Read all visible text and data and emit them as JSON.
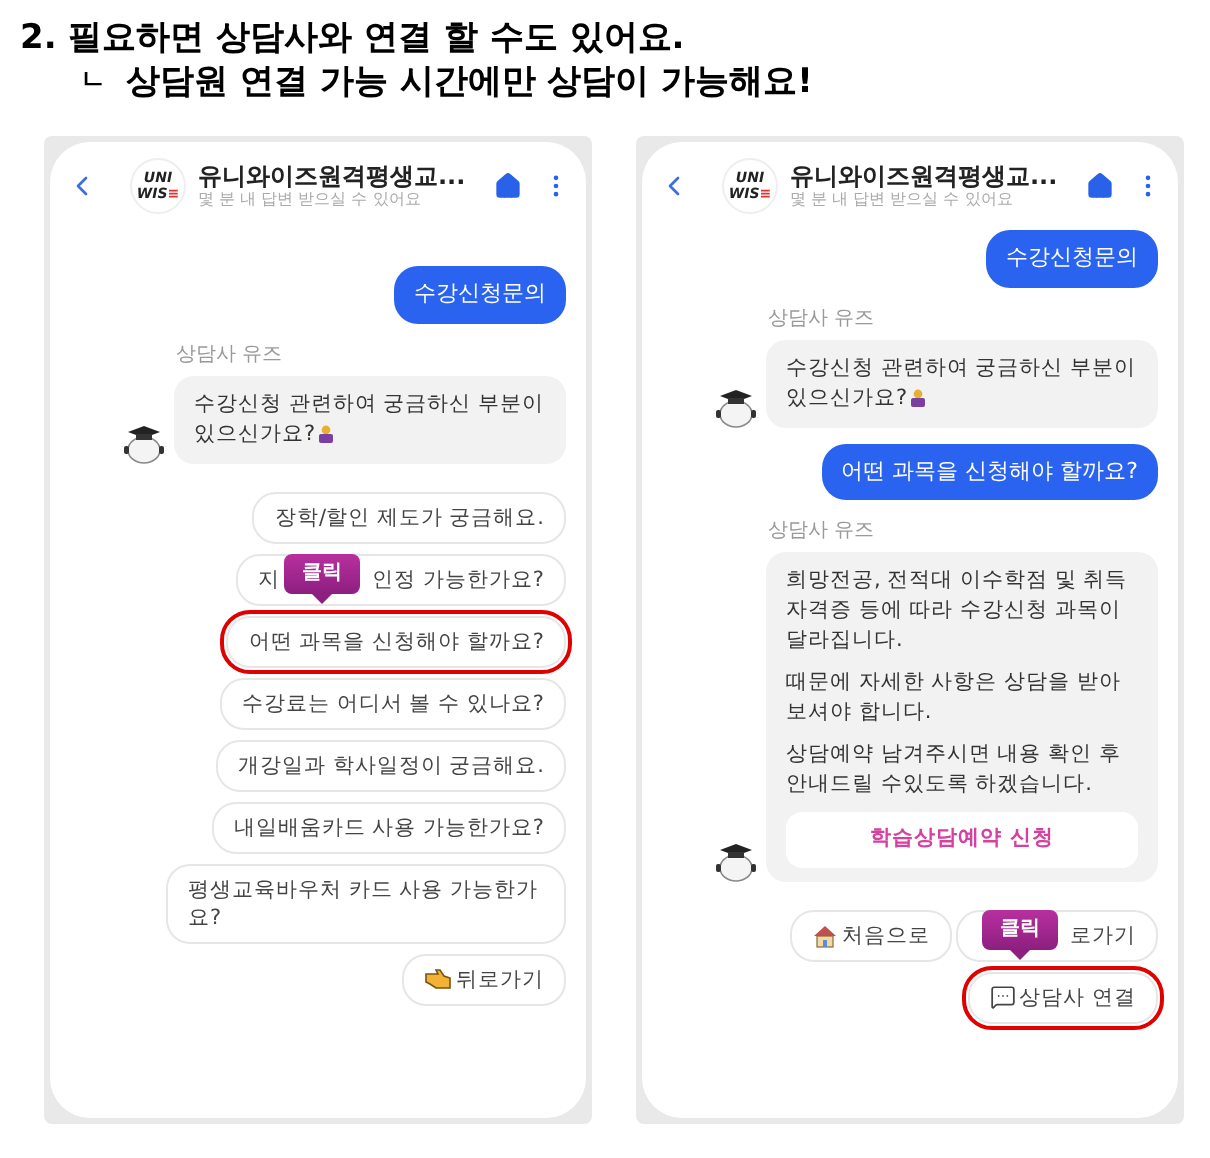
{
  "heading": {
    "line1": "2. 필요하면 상담사와 연결 할 수도 있어요.",
    "marker": "ㄴ",
    "line2": "상담원 연결 가능 시간에만 상담이 가능해요!"
  },
  "phones": [
    {
      "header": {
        "logo": [
          "UNI",
          "WIS",
          "≡"
        ],
        "title": "유니와이즈원격평생교...",
        "subtitle": "몇 분 내 답변 받으실 수 있어요"
      },
      "messages": [
        {
          "kind": "user",
          "text": "수강신청문의"
        },
        {
          "kind": "bot",
          "sender": "상담사 유즈",
          "paragraphs": [
            "수강신청 관련하여 궁금하신 부분이 있으신가요?"
          ],
          "emoji": true
        }
      ],
      "chip_rows": [
        [
          {
            "text": "장학/할인 제도가 궁금해요.",
            "highlighted": false
          }
        ],
        [
          {
            "text": "지",
            "text_after": "인정 가능한가요?",
            "highlighted": false,
            "overlay": "클릭"
          }
        ],
        [
          {
            "text": "어떤 과목을 신청해야 할까요?",
            "highlighted": true
          }
        ],
        [
          {
            "text": "수강료는 어디서 볼 수 있나요?",
            "highlighted": false
          }
        ],
        [
          {
            "text": "개강일과 학사일정이 궁금해요.",
            "highlighted": false
          }
        ],
        [
          {
            "text": "내일배움카드 사용 가능한가요?",
            "highlighted": false
          }
        ],
        [
          {
            "text": "평생교육바우처 카드 사용 가능한가요?",
            "highlighted": false
          }
        ],
        [
          {
            "kind": "hand",
            "text": "뒤로가기",
            "highlighted": false
          }
        ]
      ]
    },
    {
      "header": {
        "logo": [
          "UNI",
          "WIS",
          "≡"
        ],
        "title": "유니와이즈원격평생교...",
        "subtitle": "몇 분 내 답변 받으실 수 있어요"
      },
      "messages": [
        {
          "kind": "user",
          "text": "수강신청문의"
        },
        {
          "kind": "bot",
          "sender": "상담사 유즈",
          "paragraphs": [
            "수강신청 관련하여 궁금하신 부분이 있으신가요?"
          ],
          "emoji": true
        },
        {
          "kind": "user",
          "text": "어떤 과목을 신청해야 할까요?"
        },
        {
          "kind": "bot",
          "sender": "상담사 유즈",
          "paragraphs": [
            "희망전공, 전적대 이수학점 및 취득 자격증 등에 따라 수강신청 과목이 달라집니다.",
            "때문에 자세한 사항은 상담을 받아보셔야 합니다.",
            "상담예약 남겨주시면 내용 확인 후 안내드릴 수있도록 하겠습니다."
          ],
          "emoji": false,
          "button": "학습상담예약 신청"
        }
      ],
      "chip_rows": [
        [
          {
            "kind": "home",
            "text": "처음으로",
            "highlighted": false
          },
          {
            "text_after": "로가기",
            "highlighted": false,
            "overlay": "클릭"
          }
        ],
        [
          {
            "kind": "chat",
            "text": "상담사 연결",
            "highlighted": true
          }
        ]
      ]
    }
  ]
}
